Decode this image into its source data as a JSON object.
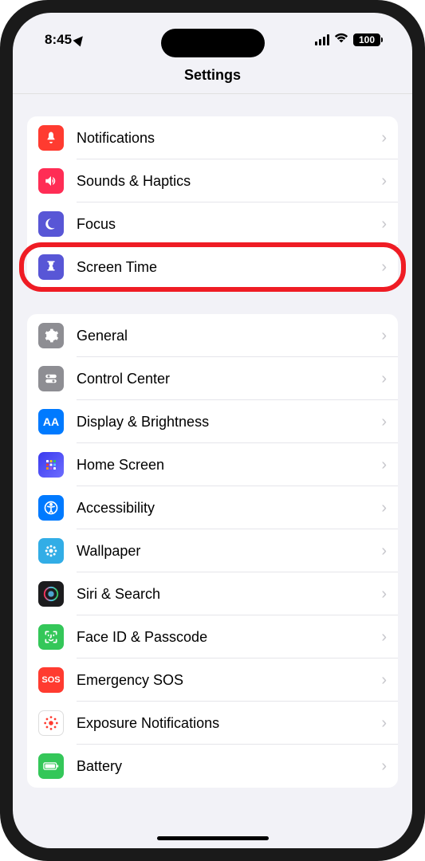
{
  "status": {
    "time": "8:45",
    "battery": "100"
  },
  "header": {
    "title": "Settings"
  },
  "group1": {
    "items": [
      {
        "label": "Notifications"
      },
      {
        "label": "Sounds & Haptics"
      },
      {
        "label": "Focus"
      },
      {
        "label": "Screen Time"
      }
    ]
  },
  "group2": {
    "items": [
      {
        "label": "General"
      },
      {
        "label": "Control Center"
      },
      {
        "label": "Display & Brightness"
      },
      {
        "label": "Home Screen"
      },
      {
        "label": "Accessibility"
      },
      {
        "label": "Wallpaper"
      },
      {
        "label": "Siri & Search"
      },
      {
        "label": "Face ID & Passcode"
      },
      {
        "label": "Emergency SOS"
      },
      {
        "label": "Exposure Notifications"
      },
      {
        "label": "Battery"
      }
    ]
  },
  "sos": "SOS"
}
